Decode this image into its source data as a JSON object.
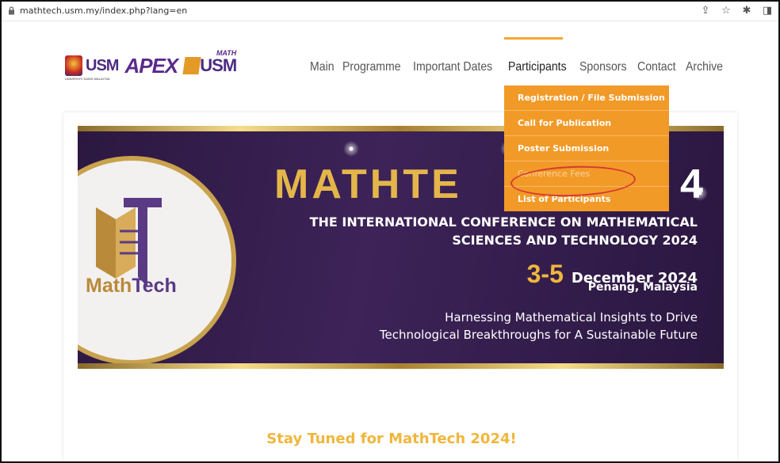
{
  "browser": {
    "url": "mathtech.usm.my/index.php?lang=en",
    "icons": [
      "lock-icon",
      "share-icon",
      "star-icon",
      "extensions-icon",
      "sidepanel-icon"
    ]
  },
  "logos": {
    "usm": "USM",
    "usm_sub": "UNIVERSITI SAINS MALAYSIA",
    "apex": "APEX",
    "mathusm_top": "MATH",
    "mathusm_main": "USM"
  },
  "nav": {
    "items": [
      "Main",
      "Programme",
      "Important Dates",
      "Participants",
      "Sponsors",
      "Contact",
      "Archive"
    ],
    "active": "Participants"
  },
  "dropdown": {
    "items": [
      "Registration / File Submission",
      "Call for Publication",
      "Poster Submission",
      "Conference Fees",
      "List of Participants"
    ],
    "highlighted": "Conference Fees"
  },
  "banner": {
    "title": "MATHTE",
    "year_tail": "4",
    "subtitle_line1": "THE INTERNATIONAL CONFERENCE ON MATHEMATICAL",
    "subtitle_line2": "SCIENCES AND TECHNOLOGY 2024",
    "date_range": "3-5",
    "date_month": "December 2024",
    "place": "Penang, Malaysia",
    "tagline_line1": "Harnessing Mathematical Insights to Drive",
    "tagline_line2": "Technological Breakthroughs for A Sustainable Future",
    "logo_word_a": "Math",
    "logo_word_b": "Tech"
  },
  "stay_tuned": "Stay Tuned for MathTech 2024!",
  "colors": {
    "accent": "#f29a27",
    "banner_bg": "#2b1840",
    "gold": "#e4b64a",
    "highlight_ring": "#d63a33"
  }
}
